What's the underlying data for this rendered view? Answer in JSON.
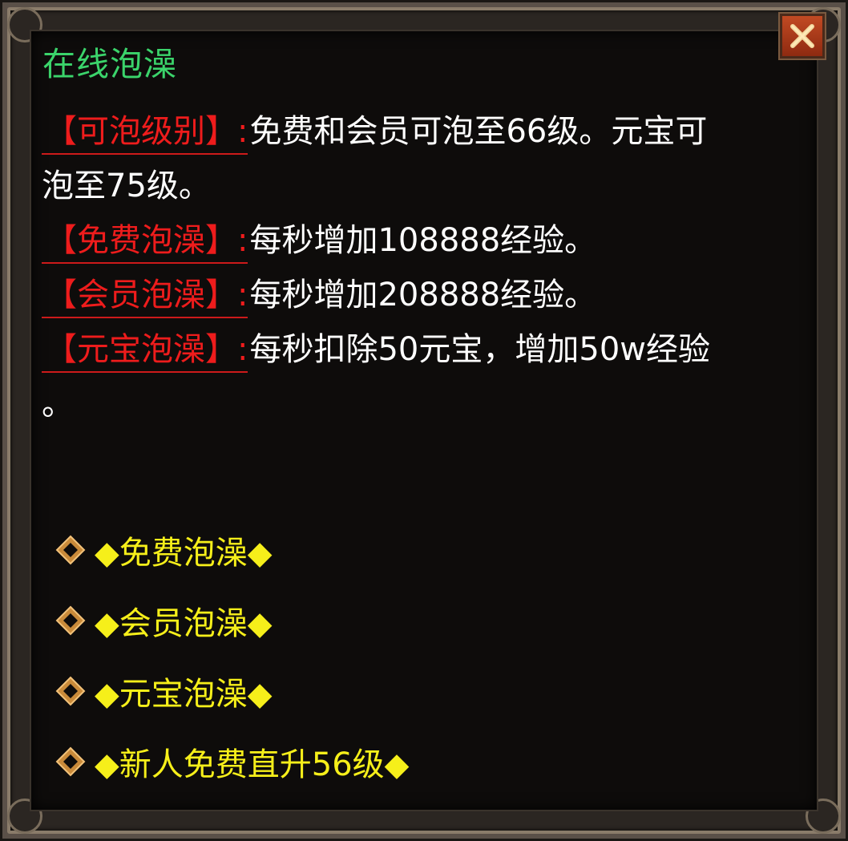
{
  "window": {
    "title": "在线泡澡",
    "close_icon": "close-icon"
  },
  "colors": {
    "title": "#3bd46b",
    "label": "#ee1c1c",
    "text": "#ffffff",
    "option": "#f6ef1a",
    "close_button": "#b43c1a"
  },
  "info": {
    "rows": [
      {
        "label": "【可泡级别】:",
        "text": "免费和会员可泡至66级。元宝可",
        "cont": "泡至75级。"
      },
      {
        "label": "【免费泡澡】:",
        "text": "每秒增加108888经验。"
      },
      {
        "label": "【会员泡澡】:",
        "text": "每秒增加208888经验。"
      },
      {
        "label": "【元宝泡澡】:",
        "text": "每秒扣除50元宝，增加50w经验",
        "cont": "。"
      }
    ]
  },
  "options": [
    {
      "label": "◆免费泡澡◆",
      "icon": "diamond-bullet-icon"
    },
    {
      "label": "◆会员泡澡◆",
      "icon": "diamond-bullet-icon"
    },
    {
      "label": "◆元宝泡澡◆",
      "icon": "diamond-bullet-icon"
    },
    {
      "label": "◆新人免费直升56级◆",
      "icon": "diamond-bullet-icon"
    }
  ]
}
